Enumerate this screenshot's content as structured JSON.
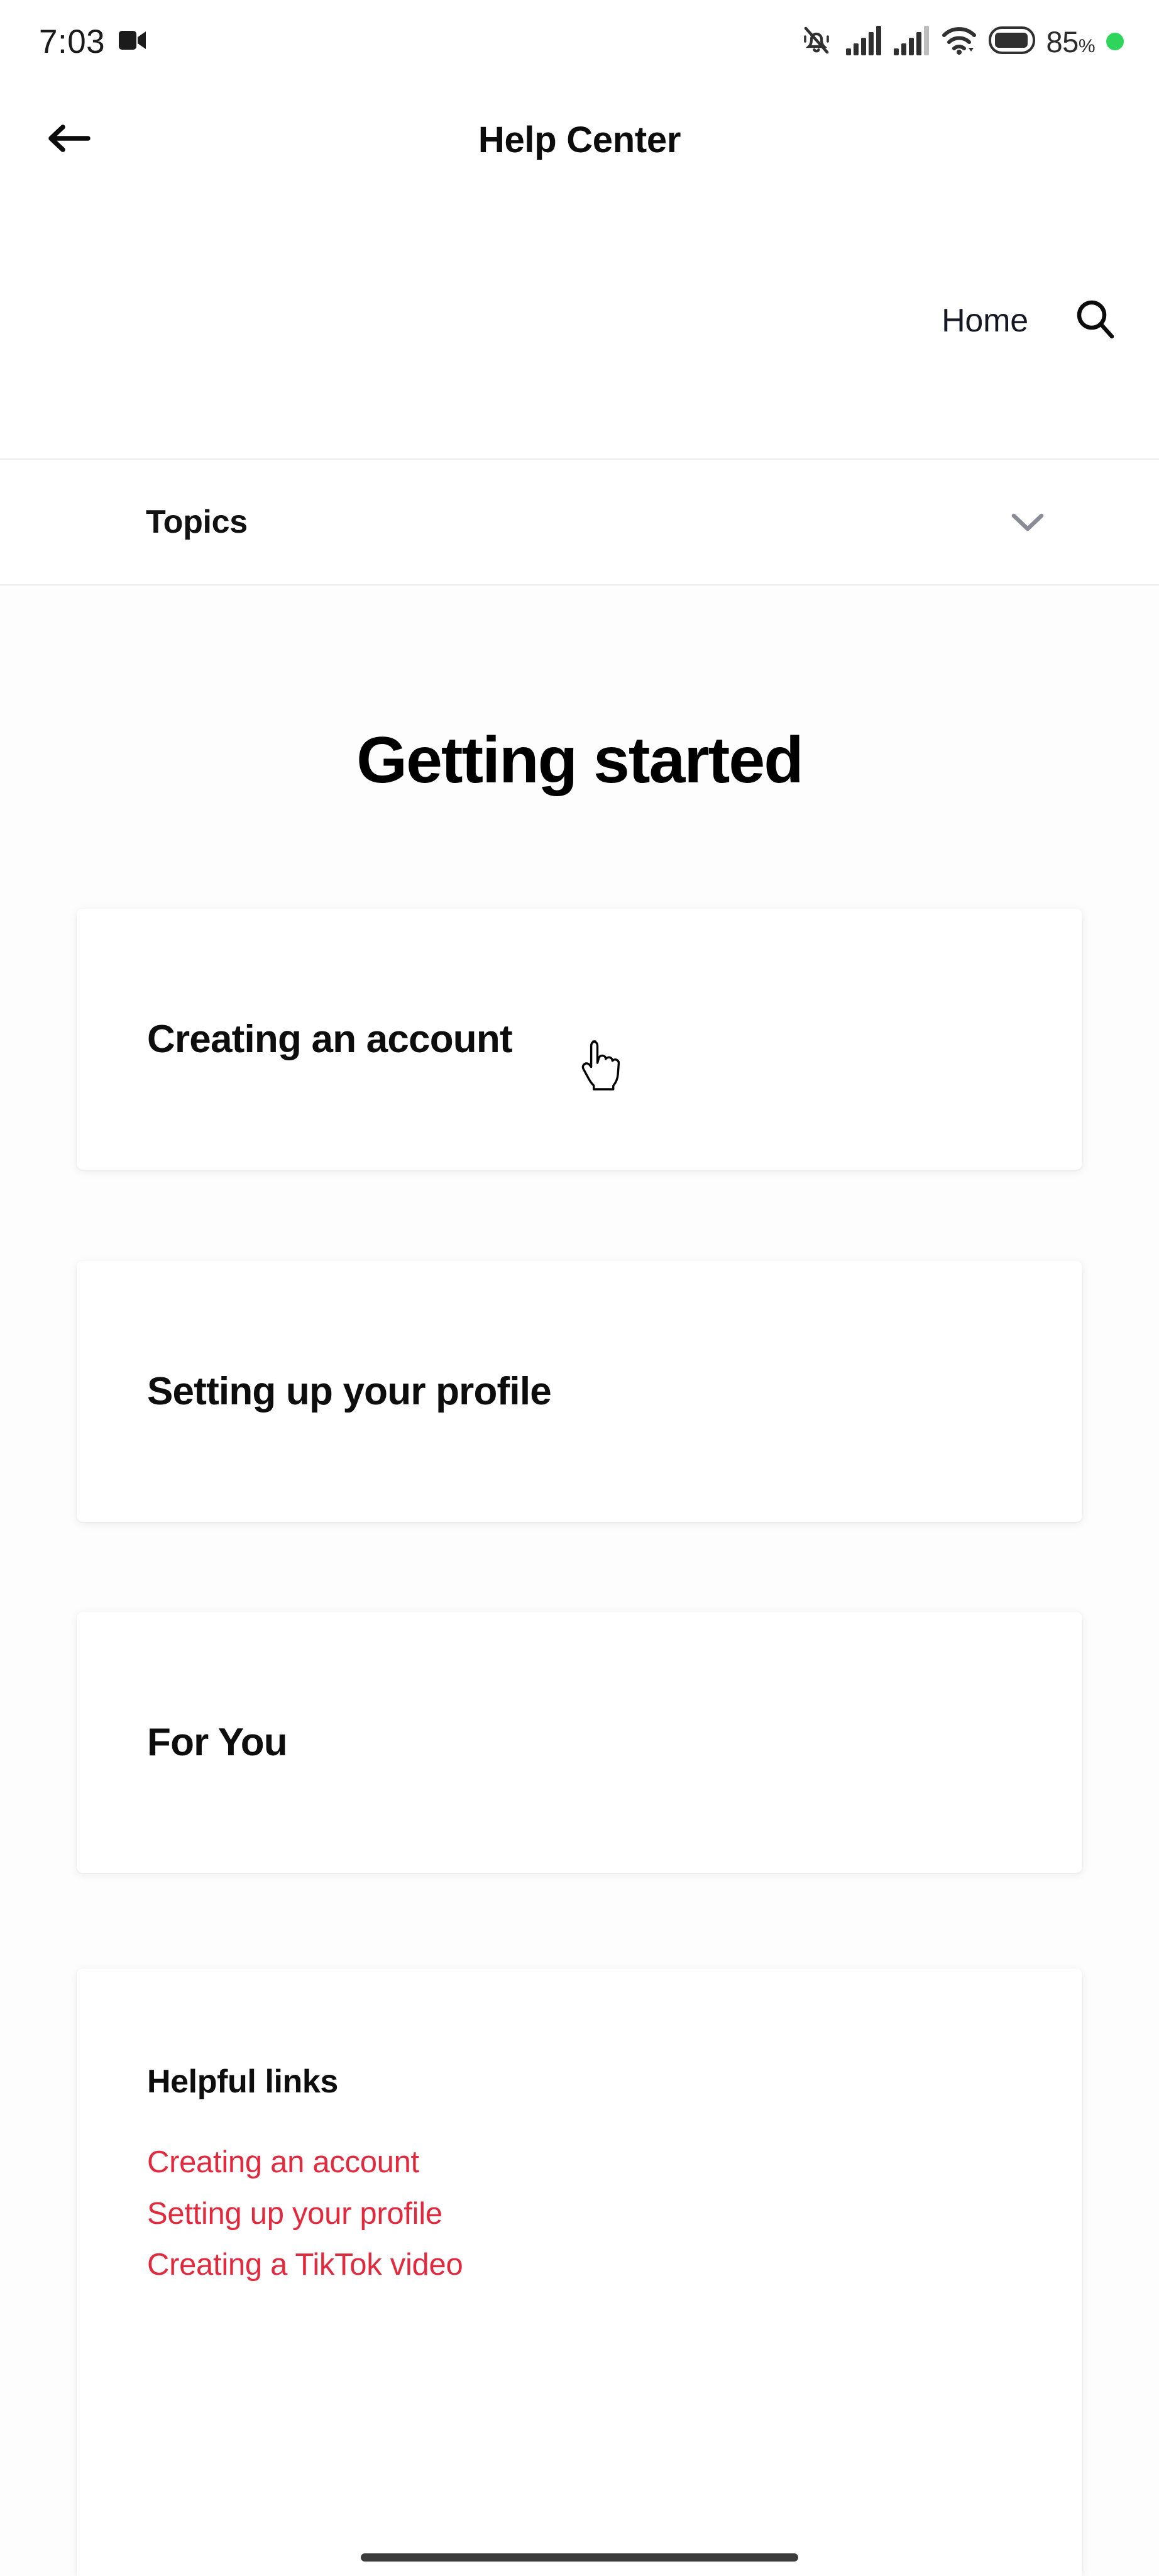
{
  "status_bar": {
    "time": "7:03",
    "left_icons": [
      "video-camera-icon"
    ],
    "right_icons": [
      "mute-bell-icon",
      "signal-bars-1-icon",
      "signal-bars-2-icon",
      "wifi-icon",
      "battery-icon"
    ],
    "battery_percent": "85",
    "percent_sign": "%",
    "recording_dot_color": "#2fd45a"
  },
  "app_bar": {
    "back_icon": "arrow-left-icon",
    "title": "Help Center"
  },
  "nav_row": {
    "home_label": "Home",
    "search_icon": "search-icon"
  },
  "topics_row": {
    "label": "Topics",
    "chevron_icon": "chevron-down-icon"
  },
  "main": {
    "page_title": "Getting started",
    "topic_cards": [
      {
        "title": "Creating an account"
      },
      {
        "title": "Setting up your profile"
      },
      {
        "title": "For You"
      }
    ],
    "helpful_links": {
      "heading": "Helpful links",
      "links": [
        "Creating an account",
        "Setting up your profile",
        "Creating a TikTok video"
      ]
    }
  },
  "cursor": {
    "type": "pointing-hand-cursor"
  },
  "colors": {
    "link_red": "#e02a3e",
    "text_primary": "#0d0d0d",
    "divider": "#ececec",
    "card_bg": "#ffffff",
    "page_bg": "#fdfdfd"
  }
}
